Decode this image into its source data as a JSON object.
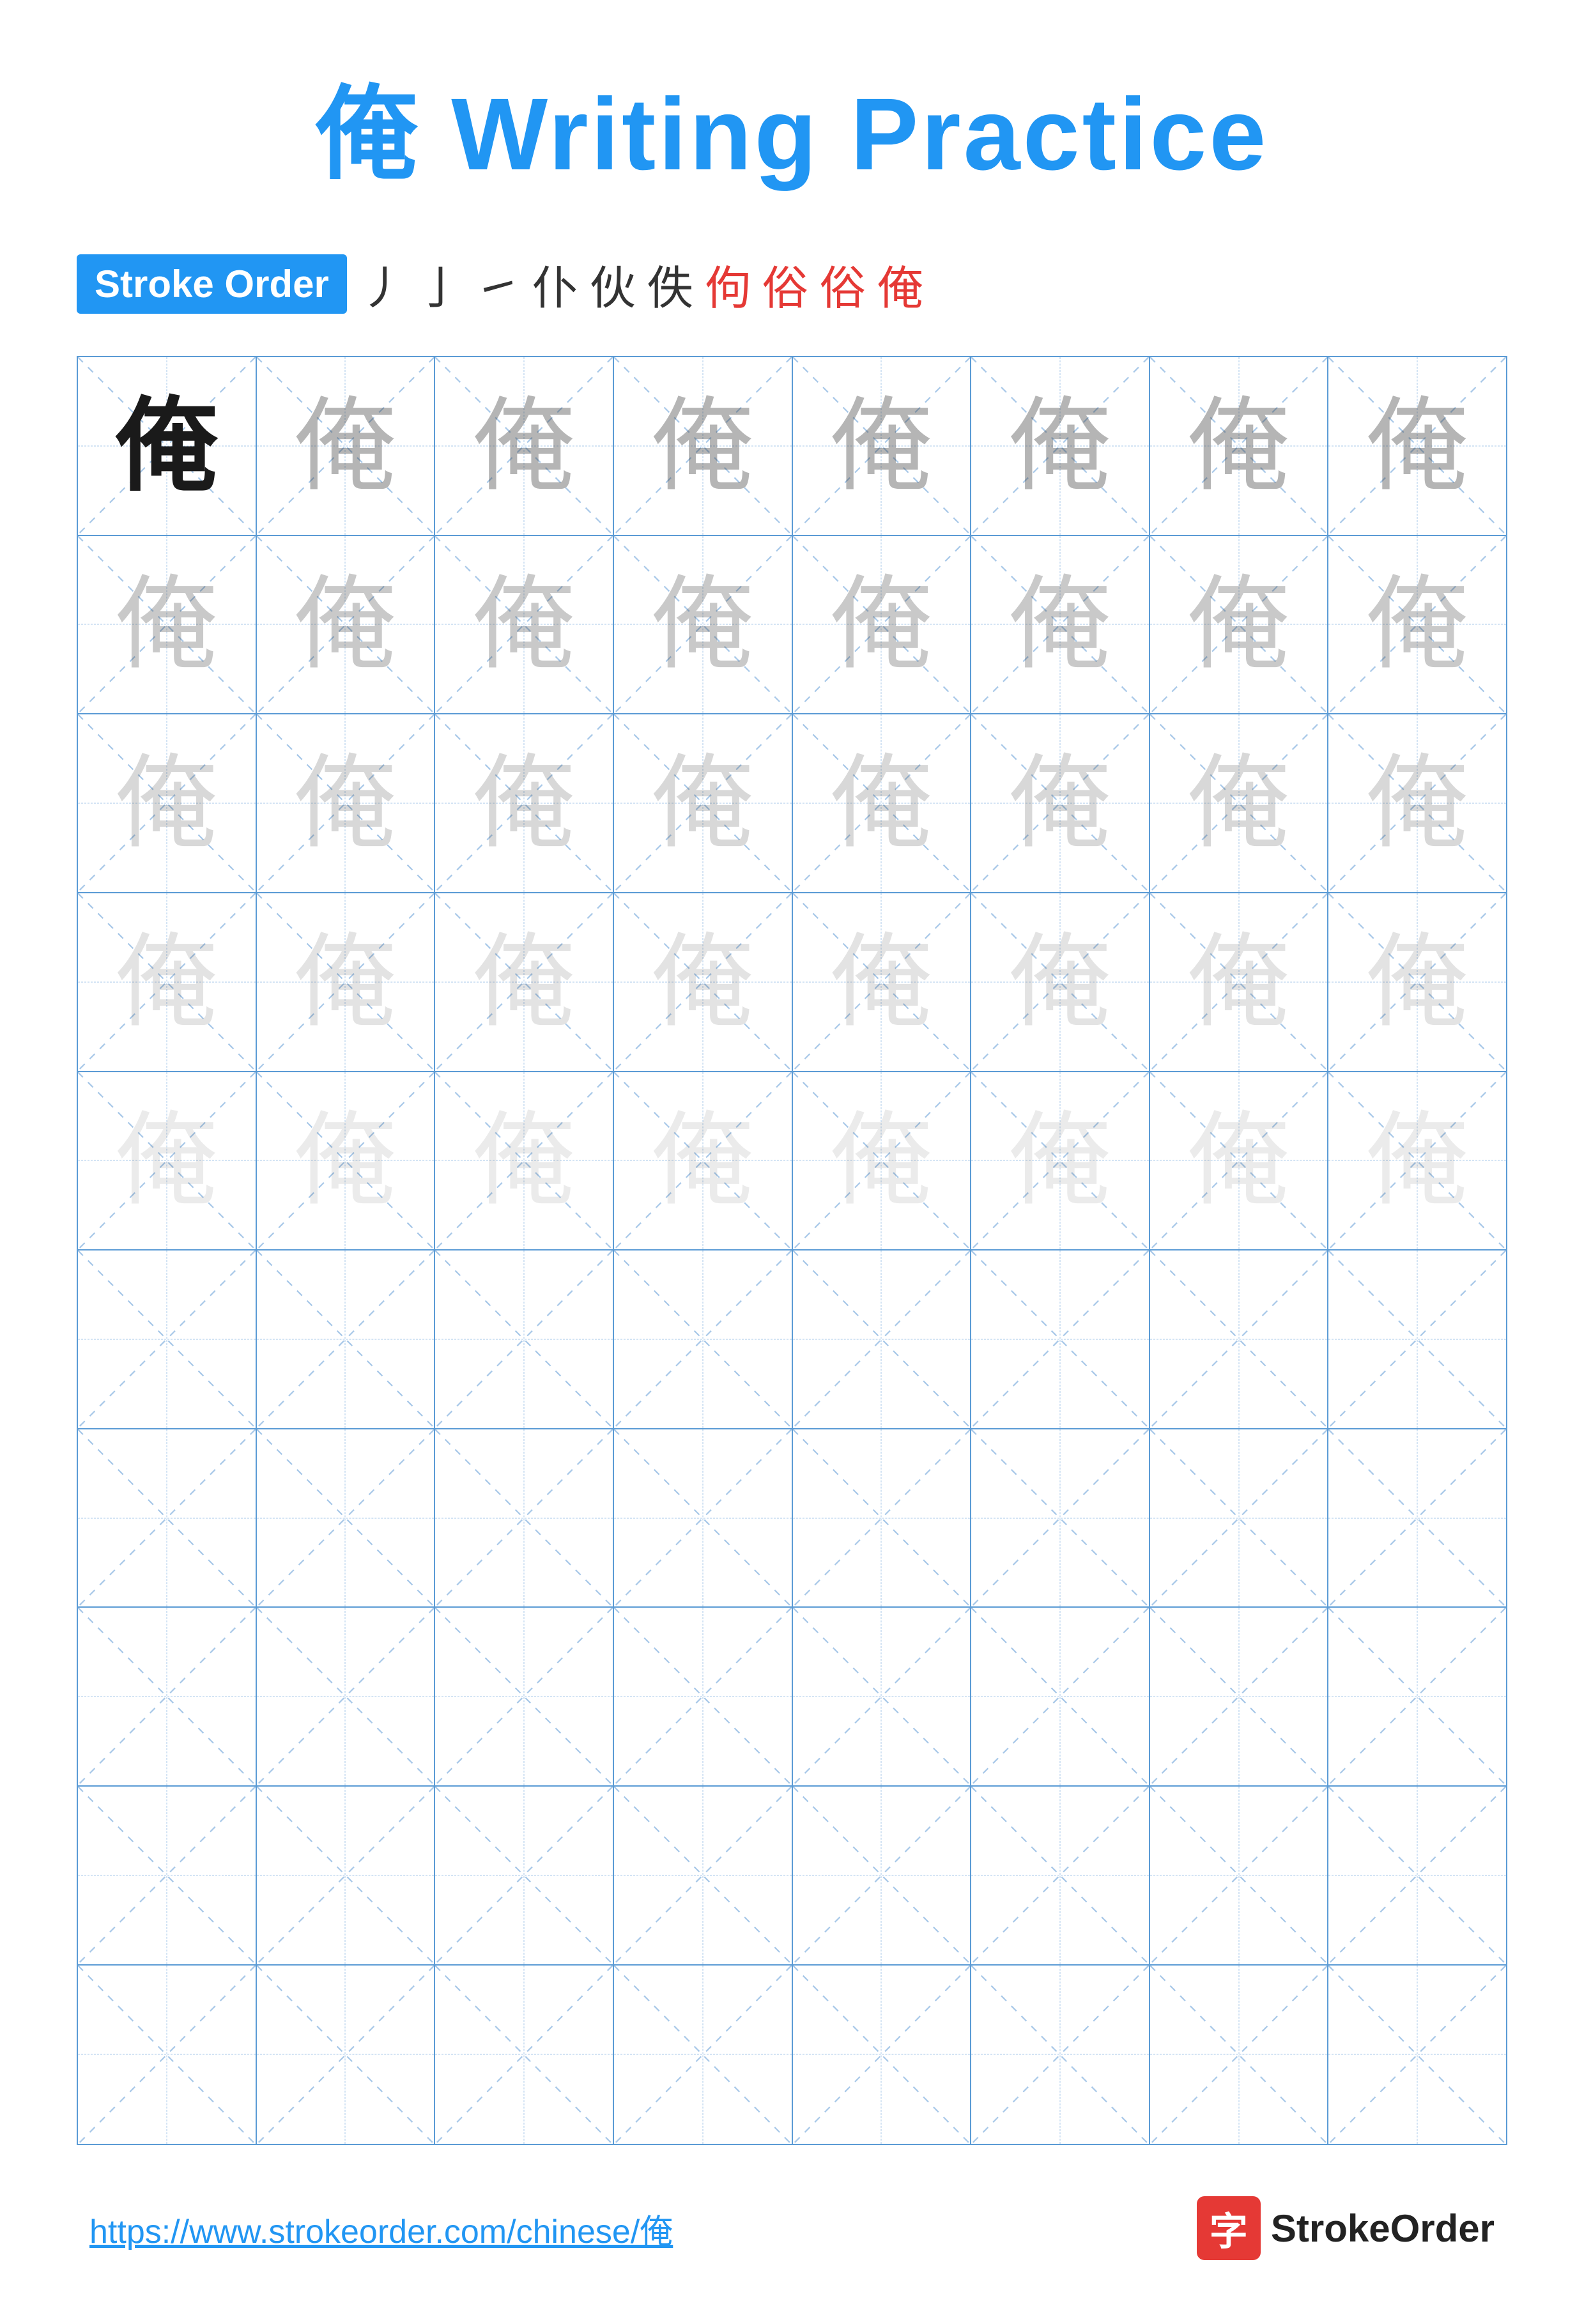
{
  "page": {
    "title": "俺 Writing Practice",
    "title_char": "俺",
    "title_suffix": " Writing Practice"
  },
  "stroke_order": {
    "label": "Stroke Order",
    "strokes": [
      "丿",
      "亅",
      "㇀",
      "仆",
      "伙",
      "佚",
      "佝",
      "俗",
      "俗",
      "俺"
    ]
  },
  "grid": {
    "rows": 10,
    "cols": 8,
    "char": "俺",
    "ghost_rows": 5
  },
  "footer": {
    "url": "https://www.strokeorder.com/chinese/俺",
    "logo_char": "字",
    "logo_text": "StrokeOrder"
  }
}
